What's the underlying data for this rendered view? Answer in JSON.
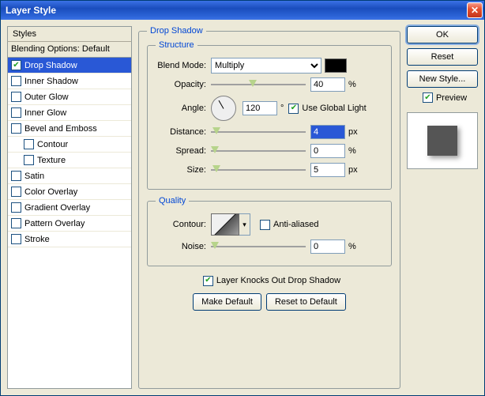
{
  "window": {
    "title": "Layer Style"
  },
  "sidebar": {
    "header": "Styles",
    "blending": "Blending Options: Default",
    "items": [
      {
        "label": "Drop Shadow",
        "checked": true,
        "selected": true
      },
      {
        "label": "Inner Shadow",
        "checked": false
      },
      {
        "label": "Outer Glow",
        "checked": false
      },
      {
        "label": "Inner Glow",
        "checked": false
      },
      {
        "label": "Bevel and Emboss",
        "checked": false
      },
      {
        "label": "Contour",
        "checked": false,
        "indent": true
      },
      {
        "label": "Texture",
        "checked": false,
        "indent": true
      },
      {
        "label": "Satin",
        "checked": false
      },
      {
        "label": "Color Overlay",
        "checked": false
      },
      {
        "label": "Gradient Overlay",
        "checked": false
      },
      {
        "label": "Pattern Overlay",
        "checked": false
      },
      {
        "label": "Stroke",
        "checked": false
      }
    ]
  },
  "main": {
    "legend": "Drop Shadow",
    "structure": {
      "legend": "Structure",
      "blend_mode_label": "Blend Mode:",
      "blend_mode_value": "Multiply",
      "swatch_color": "#000000",
      "opacity_label": "Opacity:",
      "opacity_value": "40",
      "opacity_unit": "%",
      "angle_label": "Angle:",
      "angle_value": "120",
      "angle_unit": "°",
      "global_light_label": "Use Global Light",
      "global_light_checked": true,
      "distance_label": "Distance:",
      "distance_value": "4",
      "distance_unit": "px",
      "spread_label": "Spread:",
      "spread_value": "0",
      "spread_unit": "%",
      "size_label": "Size:",
      "size_value": "5",
      "size_unit": "px"
    },
    "quality": {
      "legend": "Quality",
      "contour_label": "Contour:",
      "anti_aliased_label": "Anti-aliased",
      "anti_aliased_checked": false,
      "noise_label": "Noise:",
      "noise_value": "0",
      "noise_unit": "%"
    },
    "knockout_label": "Layer Knocks Out Drop Shadow",
    "knockout_checked": true,
    "make_default": "Make Default",
    "reset_default": "Reset to Default"
  },
  "right": {
    "ok": "OK",
    "reset": "Reset",
    "new_style": "New Style...",
    "preview_label": "Preview",
    "preview_checked": true
  }
}
